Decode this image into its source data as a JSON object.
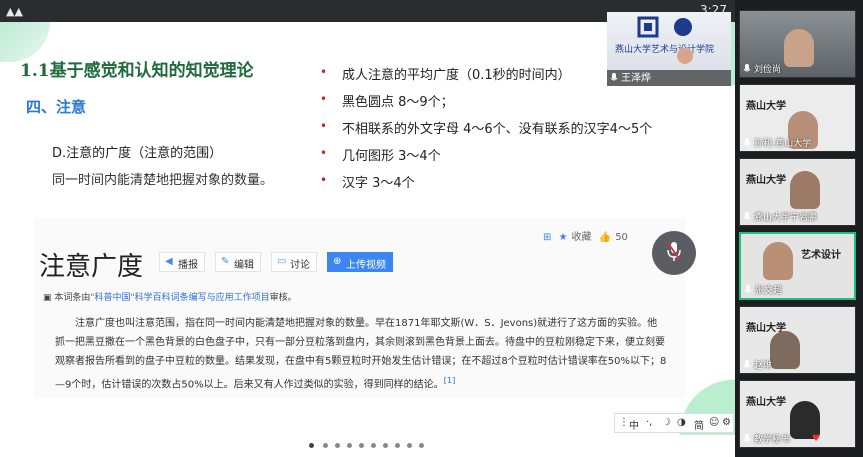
{
  "window": {
    "time": "3:27",
    "logo_glyph": "▲▲"
  },
  "slide": {
    "title": "1.1基于感觉和认知的知觉理论",
    "section": "四、注意",
    "subheading": "D.注意的广度（注意的范围）",
    "definition": "同一时间内能清楚地把握对象的数量。",
    "bullets": [
      "成人注意的平均广度（0.1秒的时间内）",
      "黑色圆点    8～9个；",
      "不相联系的外文字母    4～6个、没有联系的汉字4～5个",
      "几何图形    3～4个",
      "汉字          3～4个"
    ]
  },
  "baike": {
    "term": "注意广度",
    "buttons": {
      "report": "播报",
      "edit": "编辑",
      "discuss": "讨论",
      "upload": "上传视频"
    },
    "actions": {
      "favorite": "收藏",
      "likes": "50"
    },
    "review_note": {
      "prefix": "本词条由",
      "link": "\"科普中国\"科学百科词条编写与应用工作项目",
      "suffix": "审核。"
    },
    "paragraph": "注意广度也叫注意范围，指在同一时间内能清楚地把握对象的数量。早在1871年耶文斯(W．S．Jevons)就进行了这方面的实验。他抓一把黑豆撒在一个黑色背景的白色盘子中，只有一部分豆粒落到盘内，其余则滚到黑色背景上面去。待盘中的豆粒刚稳定下来，便立刻要观察者报告所看到的盘子中豆粒的数量。结果发现，在盘中有5颗豆粒时开始发生估计错误；在不超过8个豆粒时估计错误率在50%以下；8—9个时，估计错误的次数占50%以上。后来又有人作过类似的实验，得到同样的结论。",
    "ref": "[1]"
  },
  "ime": {
    "lang": "中",
    "mode": "简"
  },
  "presenter": {
    "name": "王泽烨"
  },
  "participants": [
    {
      "name": "刘俭尚"
    },
    {
      "name": "孙利-燕山大学"
    },
    {
      "name": "燕山大学宁岩鹏"
    },
    {
      "name": "张文超"
    },
    {
      "name": "赵琳"
    },
    {
      "name": "教学秘书"
    }
  ],
  "colors": {
    "title": "#1f6b3c",
    "section": "#2a7ad0",
    "bullet": "#d02020",
    "active_speaker": "#19c37d",
    "link": "#2f6fd6"
  },
  "pager": {
    "page_count": 10,
    "current_page": 1
  }
}
